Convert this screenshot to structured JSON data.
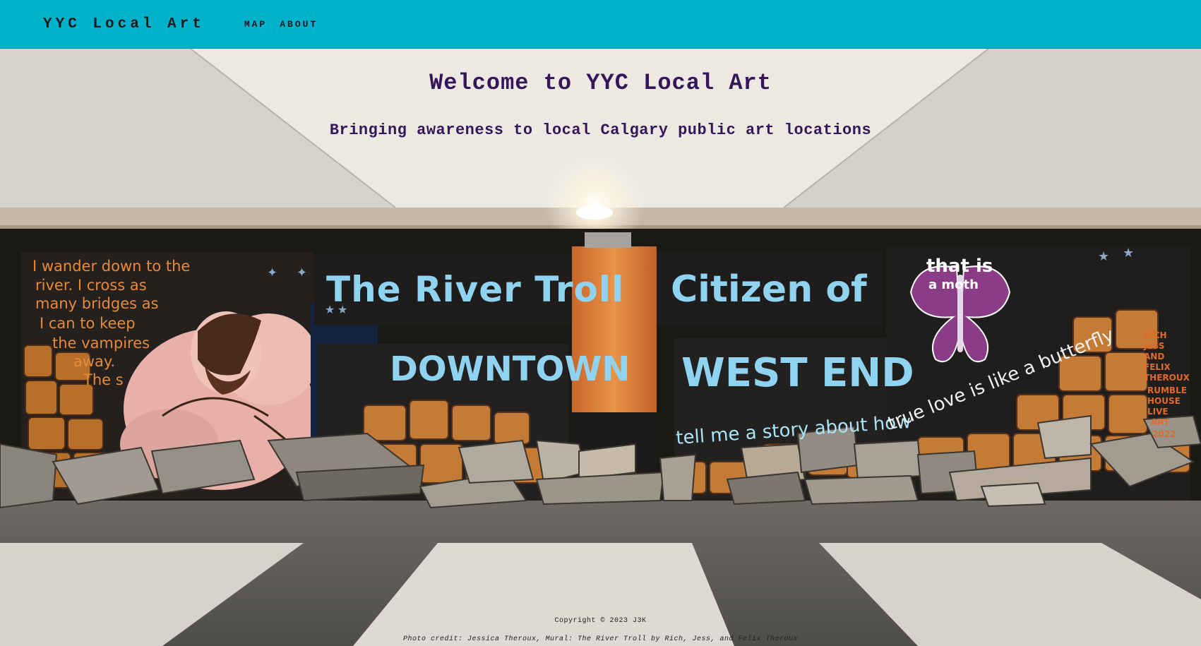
{
  "nav": {
    "brand": "YYC Local Art",
    "links": [
      {
        "label": "MAP"
      },
      {
        "label": "ABOUT"
      }
    ]
  },
  "hero": {
    "title": "Welcome to YYC Local Art",
    "subtitle": "Bringing awareness to local Calgary public art locations",
    "mural_text": {
      "river_troll": "The River Troll",
      "downtown": "DOWNTOWN",
      "citizen_of": "Citizen of",
      "west_end": "WEST END",
      "tell_me": "tell me a story about how",
      "true_love": "true love is like a butterfly",
      "poem_lines": [
        "I wander down to the",
        "river. I cross as",
        "many bridges as",
        "I can to keep",
        "the vampires",
        "away.",
        "The s"
      ],
      "that_is": "that is",
      "a_moth": "a moth",
      "signature": [
        "RICH",
        "JESS",
        "AND",
        "FELIX",
        "THEROUX",
        "RUMBLE",
        "HOUSE",
        "LIVE",
        "ART",
        "2022"
      ]
    }
  },
  "footer": {
    "copyright": "Copyright © 2023 J3K",
    "photo_credit": "Photo credit: Jessica Theroux, Mural: The River Troll by Rich, Jess, and Felix Theroux"
  },
  "colors": {
    "nav_bg": "#00b1cc",
    "heading": "#361559",
    "mural_text": "#8fd3f0"
  }
}
